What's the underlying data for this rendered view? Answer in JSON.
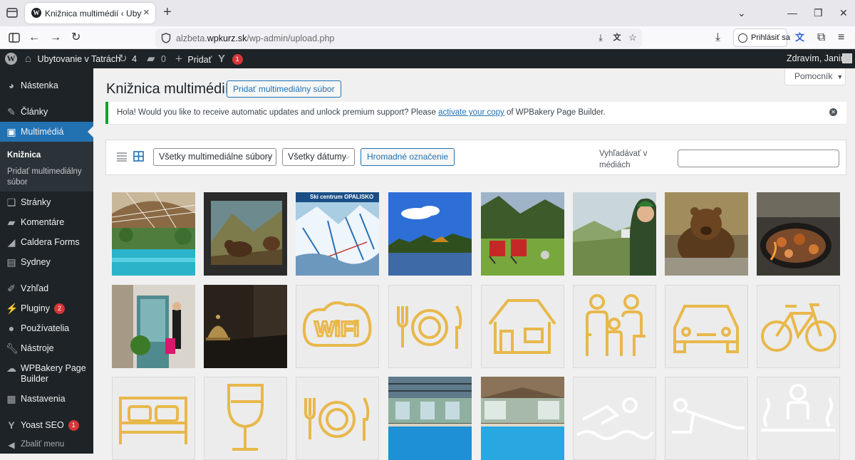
{
  "browser": {
    "tab_title": "Knižnica multimédií ‹ Ubytovanie v",
    "tab_favicon": "wordpress-icon",
    "url_host": "alzbeta.wpkurz.sk",
    "url_prefix": "alzbeta.",
    "url_domain": "wpkurz.sk",
    "url_path": "/wp-admin/upload.php",
    "signin_label": "Prihlásiť sa"
  },
  "adminbar": {
    "site_name": "Ubytovanie v Tatrách",
    "updates_count": "4",
    "comments_count": "0",
    "new_label": "Pridať",
    "yoast_count": "1",
    "greeting": "Zdravím, Janino"
  },
  "sidebar": {
    "items": [
      {
        "label": "Nástenka",
        "icon": "dashboard-icon"
      },
      {
        "label": "Články",
        "icon": "pin-icon"
      },
      {
        "label": "Multimédiá",
        "icon": "media-icon"
      },
      {
        "label": "Stránky",
        "icon": "pages-icon"
      },
      {
        "label": "Komentáre",
        "icon": "comment-icon"
      },
      {
        "label": "Caldera Forms",
        "icon": "caldera-icon"
      },
      {
        "label": "Sydney",
        "icon": "sydney-icon"
      },
      {
        "label": "Vzhľad",
        "icon": "brush-icon"
      },
      {
        "label": "Pluginy",
        "icon": "plugin-icon",
        "badge": "2"
      },
      {
        "label": "Používatelia",
        "icon": "user-icon"
      },
      {
        "label": "Nástroje",
        "icon": "wrench-icon"
      },
      {
        "label": "WPBakery Page Builder",
        "icon": "wpbakery-icon"
      },
      {
        "label": "Nastavenia",
        "icon": "settings-icon"
      },
      {
        "label": "Yoast SEO",
        "icon": "yoast-icon",
        "badge": "1"
      }
    ],
    "submenu": {
      "library": "Knižnica",
      "add_new": "Pridať multimediálny súbor"
    },
    "collapse_label": "Zbaliť menu"
  },
  "main": {
    "help_label": "Pomocník",
    "title": "Knižnica multimédií",
    "add_new_button": "Pridať multimediálny súbor",
    "notice": {
      "before": "Hola! Would you like to receive automatic updates and unlock premium support? Please ",
      "link": "activate your copy",
      "after": " of WPBakery Page Builder."
    },
    "filters": {
      "type_select": "Všetky multimediálne súbory",
      "date_select": "Všetky dátumy",
      "bulk_button": "Hromadné označenie",
      "search_label": "Vyhľadávať v médiách",
      "search_value": ""
    },
    "media_items": [
      {
        "kind": "photo",
        "subject": "indoor aquapark pool"
      },
      {
        "kind": "photo",
        "subject": "bear diorama museum"
      },
      {
        "kind": "photo",
        "subject": "ski resort map",
        "caption": "Ski centrum OPALISKO"
      },
      {
        "kind": "photo",
        "subject": "lake and forest"
      },
      {
        "kind": "photo",
        "subject": "red chairs mountain meadow"
      },
      {
        "kind": "photo",
        "subject": "woman with cup in mountains"
      },
      {
        "kind": "photo",
        "subject": "brown bear"
      },
      {
        "kind": "photo",
        "subject": "grill with food"
      },
      {
        "kind": "photo",
        "subject": "hotel entrance woman suitcase"
      },
      {
        "kind": "photo",
        "subject": "reception bell"
      },
      {
        "kind": "icon",
        "subject": "wifi-icon",
        "color": "#e8b84b"
      },
      {
        "kind": "icon",
        "subject": "dining-icon",
        "color": "#e8b84b"
      },
      {
        "kind": "icon",
        "subject": "house-icon",
        "color": "#e8b84b"
      },
      {
        "kind": "icon",
        "subject": "family-icon",
        "color": "#e8b84b"
      },
      {
        "kind": "icon",
        "subject": "car-icon",
        "color": "#e8b84b"
      },
      {
        "kind": "icon",
        "subject": "bicycle-icon",
        "color": "#e8b84b"
      },
      {
        "kind": "icon",
        "subject": "bed-icon",
        "color": "#e8b84b"
      },
      {
        "kind": "icon",
        "subject": "wine-glass-icon",
        "color": "#e8b84b"
      },
      {
        "kind": "icon",
        "subject": "dining-icon",
        "color": "#e8b84b"
      },
      {
        "kind": "photo",
        "subject": "indoor pool"
      },
      {
        "kind": "photo",
        "subject": "indoor pool"
      },
      {
        "kind": "icon",
        "subject": "swimmer-icon",
        "color": "#ffffff"
      },
      {
        "kind": "icon",
        "subject": "pushup-icon",
        "color": "#ffffff"
      },
      {
        "kind": "icon",
        "subject": "sauna-icon",
        "color": "#ffffff"
      }
    ]
  },
  "colors": {
    "adminbar": "#1d2327",
    "accent": "#2271b1",
    "badge": "#d63638",
    "notice_border": "#00a32a",
    "icon_gold": "#e8b84b"
  }
}
